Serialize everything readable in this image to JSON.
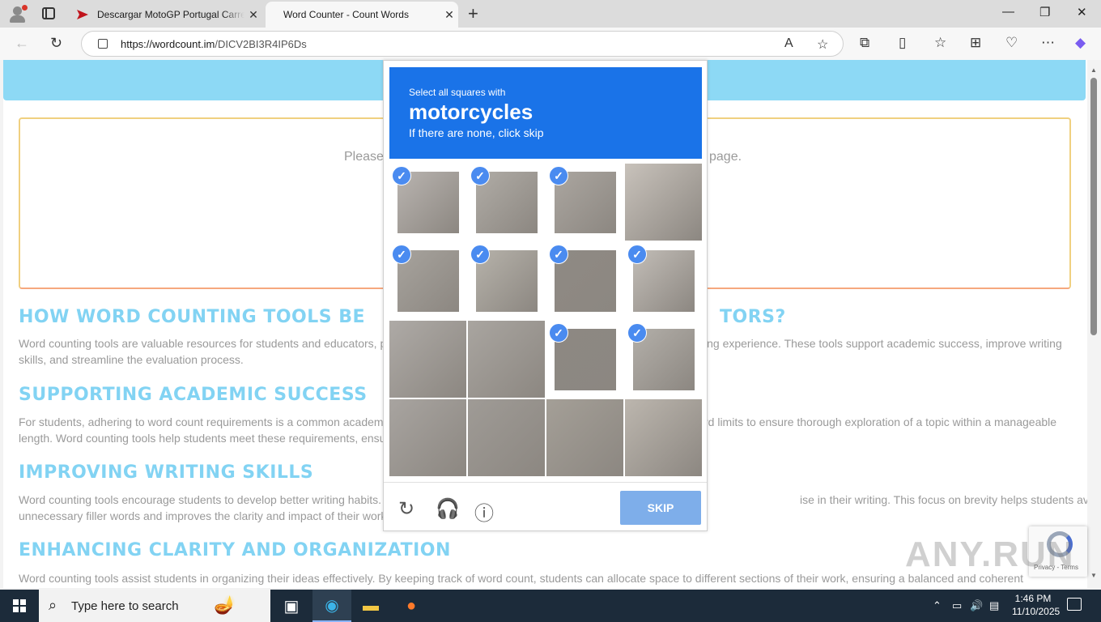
{
  "browser": {
    "tabs": [
      {
        "title": "Descargar MotoGP Portugal Carre",
        "close": "✕"
      },
      {
        "title": "Word Counter - Count Words",
        "close": "✕"
      }
    ],
    "new_tab": "+",
    "url_host": "https://wordcount.im",
    "url_path": "/DICV2BI3R4IP6Ds",
    "window": {
      "minimize": "—",
      "restore": "❐",
      "close": "✕"
    }
  },
  "page": {
    "editor_placeholder_left": "Please",
    "editor_placeholder_right": "page.",
    "sections": [
      {
        "heading_left": "HOW WORD COUNTING TOOLS BE",
        "heading_right": "TORS?",
        "text_left_1": "Word counting tools are valuable resources for students and educators, p",
        "text_right_1": "ing experience. These tools support academic success, improve writing",
        "text_2": "skills, and streamline the evaluation process."
      },
      {
        "heading": "SUPPORTING ACADEMIC SUCCESS",
        "text_left_1": "For students, adhering to word count requirements is a common academ",
        "text_right_1": "rd limits to ensure thorough exploration of a topic within a manageable",
        "text_2": "length. Word counting tools help students meet these requirements, ensu"
      },
      {
        "heading": "IMPROVING WRITING SKILLS",
        "text_left_1": "Word counting tools encourage students to develop better writing habits.",
        "text_right_1": "ise in their writing. This focus on brevity helps students avoid",
        "text_2": "unnecessary filler words and improves the clarity and impact of their work"
      },
      {
        "heading": "ENHANCING CLARITY AND ORGANIZATION",
        "text_1": "Word counting tools assist students in organizing their ideas effectively. By keeping track of word count, students can allocate space to different sections of their work, ensuring a balanced and coherent"
      }
    ]
  },
  "captcha": {
    "instruction": "Select all squares with",
    "object": "motorcycles",
    "hint": "If there are none, click skip",
    "skip_label": "SKIP",
    "selected": [
      true,
      true,
      true,
      false,
      true,
      true,
      true,
      true,
      false,
      false,
      true,
      true,
      false,
      false,
      false,
      false
    ],
    "badge_terms": "Privacy - Terms",
    "colors": {
      "header": "#1a73e8",
      "check": "#4a8bf0",
      "skip_button": "#7eaeea"
    }
  },
  "watermark": "ANY.RUN",
  "taskbar": {
    "search_placeholder": "Type here to search",
    "time": "1:46 PM",
    "date": "11/10/2025"
  },
  "colors": {
    "heading": "#82d3f3",
    "hero": "#8dd9f5",
    "taskbar": "#1c2b3a"
  }
}
